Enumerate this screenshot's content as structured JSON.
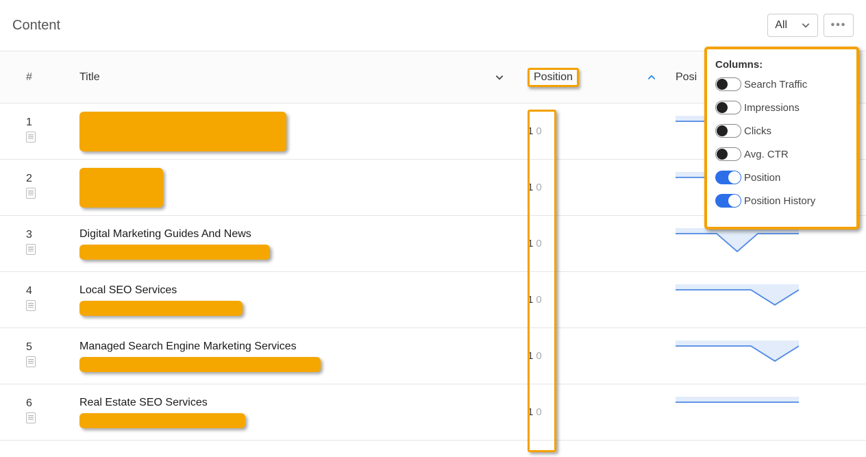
{
  "header": {
    "title": "Content",
    "filter_label": "All"
  },
  "columns": {
    "num": "#",
    "title": "Title",
    "position": "Position",
    "history": "Posi"
  },
  "rows": [
    {
      "n": "1",
      "title": "",
      "redact_w": 302,
      "pos_main": "1",
      "pos_sub": "0",
      "spark": "flat-dip"
    },
    {
      "n": "2",
      "title": "",
      "redact_w": 122,
      "pos_main": "1",
      "pos_sub": "0",
      "spark": "flat-dip"
    },
    {
      "n": "3",
      "title": "Digital Marketing Guides And News",
      "redact_w": 278,
      "pos_main": "1",
      "pos_sub": "0",
      "spark": "v-dip"
    },
    {
      "n": "4",
      "title": "Local SEO Services",
      "redact_w": 238,
      "pos_main": "1",
      "pos_sub": "0",
      "spark": "end-dip"
    },
    {
      "n": "5",
      "title": "Managed Search Engine Marketing Services",
      "redact_w": 352,
      "pos_main": "1",
      "pos_sub": "0",
      "spark": "end-dip"
    },
    {
      "n": "6",
      "title": "Real Estate SEO Services",
      "redact_w": 242,
      "pos_main": "1",
      "pos_sub": "0",
      "spark": "flat"
    }
  ],
  "panel": {
    "title": "Columns:",
    "options": [
      {
        "label": "Search Traffic",
        "on": false
      },
      {
        "label": "Impressions",
        "on": false
      },
      {
        "label": "Clicks",
        "on": false
      },
      {
        "label": "Avg. CTR",
        "on": false
      },
      {
        "label": "Position",
        "on": true
      },
      {
        "label": "Position History",
        "on": true
      }
    ]
  },
  "chart_data": [
    {
      "type": "line",
      "row": 1,
      "x": [
        0,
        1,
        2,
        3,
        4,
        5,
        6
      ],
      "values": [
        1,
        1,
        1,
        1,
        1,
        1,
        1
      ],
      "note": "mostly flat, tiny dip toward end"
    },
    {
      "type": "line",
      "row": 2,
      "x": [
        0,
        1,
        2,
        3,
        4,
        5,
        6
      ],
      "values": [
        1,
        1,
        1,
        1,
        1,
        1,
        1
      ]
    },
    {
      "type": "line",
      "row": 3,
      "x": [
        0,
        1,
        2,
        3,
        4,
        5,
        6
      ],
      "values": [
        1,
        1,
        1,
        3,
        1,
        1,
        1
      ],
      "note": "single v-shaped dip in middle"
    },
    {
      "type": "line",
      "row": 4,
      "x": [
        0,
        1,
        2,
        3,
        4,
        5,
        6
      ],
      "values": [
        1,
        1,
        1,
        1,
        1,
        3,
        1
      ],
      "note": "dip near end then back up"
    },
    {
      "type": "line",
      "row": 5,
      "x": [
        0,
        1,
        2,
        3,
        4,
        5,
        6
      ],
      "values": [
        1,
        1,
        1,
        1,
        1,
        3,
        1
      ]
    },
    {
      "type": "line",
      "row": 6,
      "x": [
        0,
        1,
        2,
        3,
        4,
        5,
        6
      ],
      "values": [
        1,
        1,
        1,
        1,
        1,
        1,
        1
      ]
    }
  ]
}
